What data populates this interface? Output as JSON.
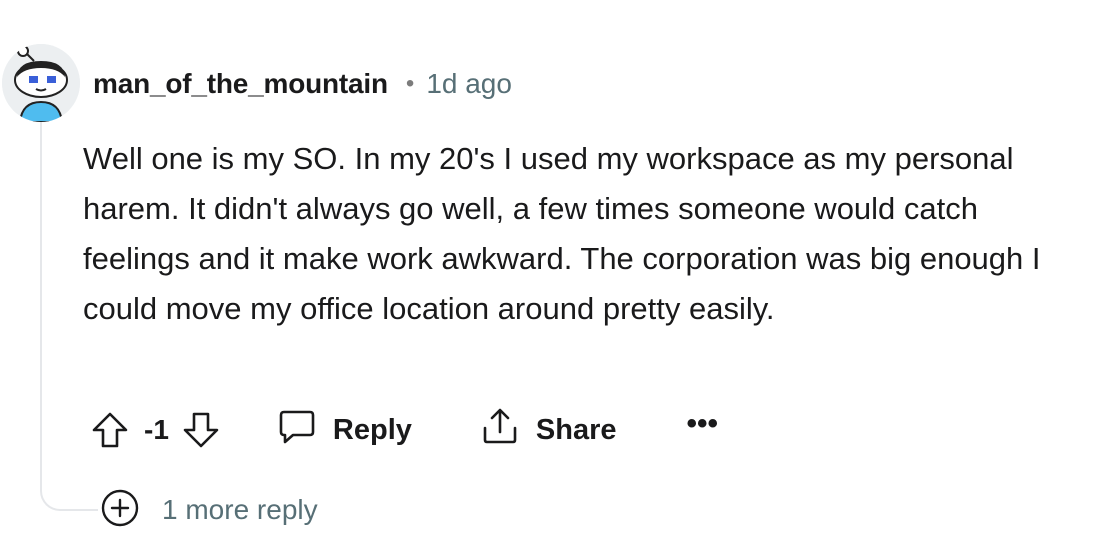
{
  "comment": {
    "username": "man_of_the_mountain",
    "separator": "•",
    "time_ago": "1d ago",
    "body": "Well one is my SO. In my 20's I used my workspace as my personal harem. It didn't always go well, a few times someone would catch feelings and it make work awkward. The corporation was big enough I could move my office location around pretty easily.",
    "avatar_icon": "snoo-avatar-icon"
  },
  "actions": {
    "upvote_icon": "upvote-arrow-icon",
    "vote_count": "-1",
    "downvote_icon": "downvote-arrow-icon",
    "reply_label": "Reply",
    "reply_icon": "speech-bubble-icon",
    "share_label": "Share",
    "share_icon": "share-icon",
    "more_label": "•••"
  },
  "more_replies": {
    "label": "1 more reply",
    "icon": "plus-circle-icon"
  },
  "colors": {
    "text": "#1a1a1b",
    "meta": "#576f76",
    "thread_line": "#e5e7ea",
    "avatar_body": "#4fbcef"
  }
}
